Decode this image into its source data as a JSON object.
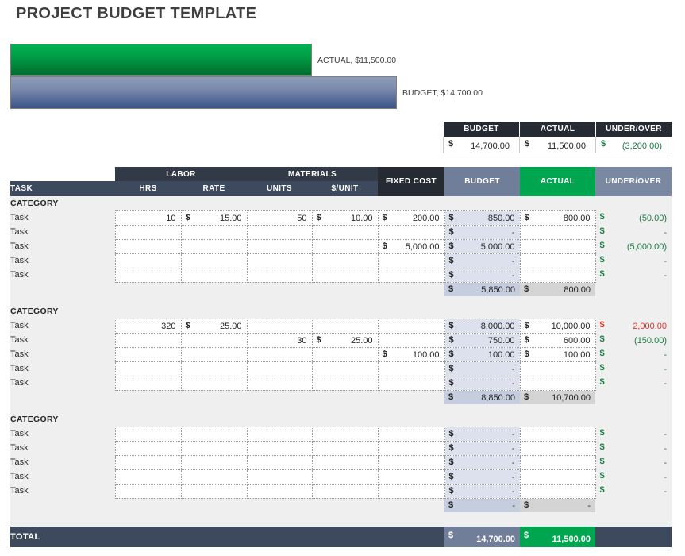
{
  "title": "PROJECT BUDGET TEMPLATE",
  "chart_data": {
    "type": "bar",
    "title": "PROJECT BUDGET TEMPLATE",
    "orientation": "horizontal",
    "categories": [
      "ACTUAL",
      "BUDGET"
    ],
    "values": [
      11500.0,
      14700.0
    ],
    "value_labels": [
      "ACTUAL,  $11,500.00",
      "BUDGET,  $14,700.00"
    ],
    "colors": [
      "#00a550",
      "#7d8dae"
    ],
    "xlabel": "",
    "ylabel": "",
    "grid": false,
    "legend": "none",
    "xlim": [
      0,
      16000
    ]
  },
  "summary": {
    "headers": [
      "BUDGET",
      "ACTUAL",
      "UNDER/OVER"
    ],
    "budget": {
      "currency": "$",
      "amount": "14,700.00"
    },
    "actual": {
      "currency": "$",
      "amount": "11,500.00"
    },
    "under_over": {
      "currency": "$",
      "amount": "(3,200.00)",
      "state": "pos"
    }
  },
  "table": {
    "group_headers": {
      "labor": "LABOR",
      "materials": "MATERIALS"
    },
    "headers": {
      "task": "TASK",
      "hrs": "HRS",
      "rate": "RATE",
      "units": "UNITS",
      "unit_price": "$/UNIT",
      "fixed_cost": "FIXED COST",
      "budget": "BUDGET",
      "actual": "ACTUAL",
      "under_over": "UNDER/OVER"
    },
    "category_label": "CATEGORY",
    "task_label": "Task",
    "currency": "$",
    "dash": "-",
    "sections": [
      {
        "name": "CATEGORY",
        "rows": [
          {
            "task": "Task",
            "hrs": "10",
            "rate": "15.00",
            "units": "50",
            "unit_price": "10.00",
            "fixed": "200.00",
            "budget": "850.00",
            "actual": "800.00",
            "under_over": "(50.00)",
            "state": "pos"
          },
          {
            "task": "Task",
            "hrs": "",
            "rate": "",
            "units": "",
            "unit_price": "",
            "fixed": "",
            "budget": "-",
            "actual": "",
            "under_over": "-",
            "state": "pos"
          },
          {
            "task": "Task",
            "hrs": "",
            "rate": "",
            "units": "",
            "unit_price": "",
            "fixed": "5,000.00",
            "budget": "5,000.00",
            "actual": "",
            "under_over": "(5,000.00)",
            "state": "pos"
          },
          {
            "task": "Task",
            "hrs": "",
            "rate": "",
            "units": "",
            "unit_price": "",
            "fixed": "",
            "budget": "-",
            "actual": "",
            "under_over": "-",
            "state": "pos"
          },
          {
            "task": "Task",
            "hrs": "",
            "rate": "",
            "units": "",
            "unit_price": "",
            "fixed": "",
            "budget": "-",
            "actual": "",
            "under_over": "-",
            "state": "pos"
          }
        ],
        "subtotal": {
          "budget": "5,850.00",
          "actual": "800.00"
        }
      },
      {
        "name": "CATEGORY",
        "rows": [
          {
            "task": "Task",
            "hrs": "320",
            "rate": "25.00",
            "units": "",
            "unit_price": "",
            "fixed": "",
            "budget": "8,000.00",
            "actual": "10,000.00",
            "under_over": "2,000.00",
            "state": "neg"
          },
          {
            "task": "Task",
            "hrs": "",
            "rate": "",
            "units": "30",
            "unit_price": "25.00",
            "fixed": "",
            "budget": "750.00",
            "actual": "600.00",
            "under_over": "(150.00)",
            "state": "pos"
          },
          {
            "task": "Task",
            "hrs": "",
            "rate": "",
            "units": "",
            "unit_price": "",
            "fixed": "100.00",
            "budget": "100.00",
            "actual": "100.00",
            "under_over": "-",
            "state": "pos"
          },
          {
            "task": "Task",
            "hrs": "",
            "rate": "",
            "units": "",
            "unit_price": "",
            "fixed": "",
            "budget": "-",
            "actual": "",
            "under_over": "-",
            "state": "pos"
          },
          {
            "task": "Task",
            "hrs": "",
            "rate": "",
            "units": "",
            "unit_price": "",
            "fixed": "",
            "budget": "-",
            "actual": "",
            "under_over": "-",
            "state": "pos"
          }
        ],
        "subtotal": {
          "budget": "8,850.00",
          "actual": "10,700.00"
        }
      },
      {
        "name": "CATEGORY",
        "rows": [
          {
            "task": "Task",
            "hrs": "",
            "rate": "",
            "units": "",
            "unit_price": "",
            "fixed": "",
            "budget": "-",
            "actual": "",
            "under_over": "-",
            "state": "pos"
          },
          {
            "task": "Task",
            "hrs": "",
            "rate": "",
            "units": "",
            "unit_price": "",
            "fixed": "",
            "budget": "-",
            "actual": "",
            "under_over": "-",
            "state": "pos"
          },
          {
            "task": "Task",
            "hrs": "",
            "rate": "",
            "units": "",
            "unit_price": "",
            "fixed": "",
            "budget": "-",
            "actual": "",
            "under_over": "-",
            "state": "pos"
          },
          {
            "task": "Task",
            "hrs": "",
            "rate": "",
            "units": "",
            "unit_price": "",
            "fixed": "",
            "budget": "-",
            "actual": "",
            "under_over": "-",
            "state": "pos"
          },
          {
            "task": "Task",
            "hrs": "",
            "rate": "",
            "units": "",
            "unit_price": "",
            "fixed": "",
            "budget": "-",
            "actual": "",
            "under_over": "-",
            "state": "pos"
          }
        ],
        "subtotal": {
          "budget": "-",
          "actual": "-"
        }
      }
    ],
    "total": {
      "label": "TOTAL",
      "budget": "14,700.00",
      "actual": "11,500.00"
    }
  },
  "colors": {
    "green": "#00a550",
    "navy": "#3d4a5e",
    "dark": "#262b33",
    "budget_blue": "#707e99",
    "positive": "#1f7a45",
    "negative": "#d8382f"
  }
}
